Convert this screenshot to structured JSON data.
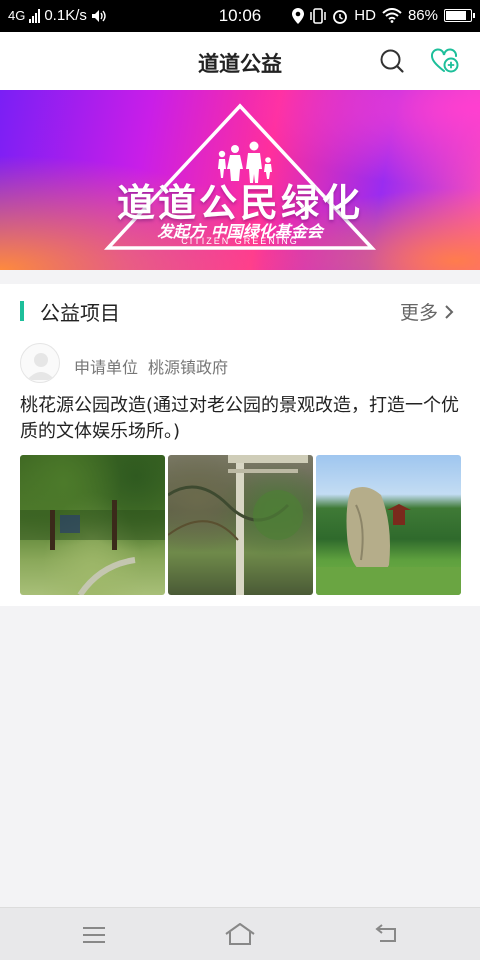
{
  "status_bar": {
    "network": "4G",
    "speed": "0.1K/s",
    "time": "10:06",
    "hd": "HD",
    "battery": "86%",
    "battery_level": 0.86
  },
  "header": {
    "title": "道道公益",
    "search_icon": "search-icon",
    "heart_add_icon": "heart-add-icon",
    "accent_color": "#1dbf9a"
  },
  "banner": {
    "title": "道道公民绿化",
    "sponsor": "发起方 中国绿化基金会",
    "subtitle": "CITIZEN GREENING"
  },
  "section": {
    "title": "公益项目",
    "more_label": "更多"
  },
  "project": {
    "applicant_label": "申请单位",
    "applicant_name": "桃源镇政府",
    "description": "桃花源公园改造(通过对老公园的景观改造，打造一个优质的文体娱乐场所。)",
    "photos": [
      "park-photo",
      "overgrown-arbor-photo",
      "stone-monument-photo"
    ]
  },
  "nav": {
    "menu_icon": "menu-icon",
    "home_icon": "home-icon",
    "back_icon": "back-icon"
  }
}
